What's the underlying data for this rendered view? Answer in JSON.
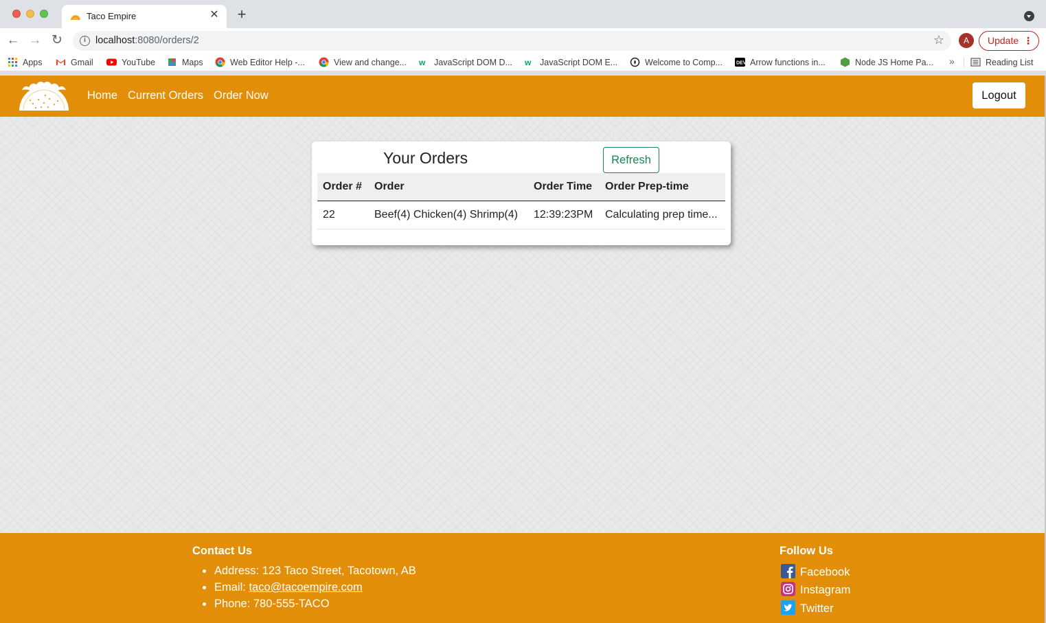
{
  "browser": {
    "tab_title": "Taco Empire",
    "url_host": "localhost",
    "url_path": ":8080/orders/2",
    "avatar_letter": "A",
    "update_label": "Update",
    "bookmarks": [
      {
        "label": "Apps",
        "icon": "apps-grid-icon"
      },
      {
        "label": "Gmail",
        "icon": "gmail-icon"
      },
      {
        "label": "YouTube",
        "icon": "youtube-icon"
      },
      {
        "label": "Maps",
        "icon": "maps-icon"
      },
      {
        "label": "Web Editor Help -...",
        "icon": "chrome-icon"
      },
      {
        "label": "View and change...",
        "icon": "chrome-icon"
      },
      {
        "label": "JavaScript DOM D...",
        "icon": "w3schools-icon"
      },
      {
        "label": "JavaScript DOM E...",
        "icon": "w3schools-icon"
      },
      {
        "label": "Welcome to Comp...",
        "icon": "compass-icon"
      },
      {
        "label": "Arrow functions in...",
        "icon": "dev-icon"
      },
      {
        "label": "Node JS Home Pa...",
        "icon": "nodejs-icon"
      }
    ],
    "reading_list": "Reading List"
  },
  "site": {
    "colors": {
      "brand": "#e38e08",
      "refresh": "#198754"
    },
    "nav": {
      "links": [
        "Home",
        "Current Orders",
        "Order Now"
      ],
      "logout": "Logout"
    },
    "orders": {
      "title": "Your Orders",
      "refresh": "Refresh",
      "headers": [
        "Order #",
        "Order",
        "Order Time",
        "Order Prep-time"
      ],
      "rows": [
        [
          "22",
          "Beef(4) Chicken(4) Shrimp(4)",
          "12:39:23PM",
          "Calculating prep time..."
        ]
      ]
    },
    "footer": {
      "contact_heading": "Contact Us",
      "address": "Address: 123 Taco Street, Tacotown, AB",
      "email_prefix": "Email: ",
      "email": "taco@tacoempire.com",
      "phone": "Phone: 780-555-TACO",
      "follow_heading": "Follow Us",
      "social": [
        "Facebook",
        "Instagram",
        "Twitter"
      ]
    }
  }
}
